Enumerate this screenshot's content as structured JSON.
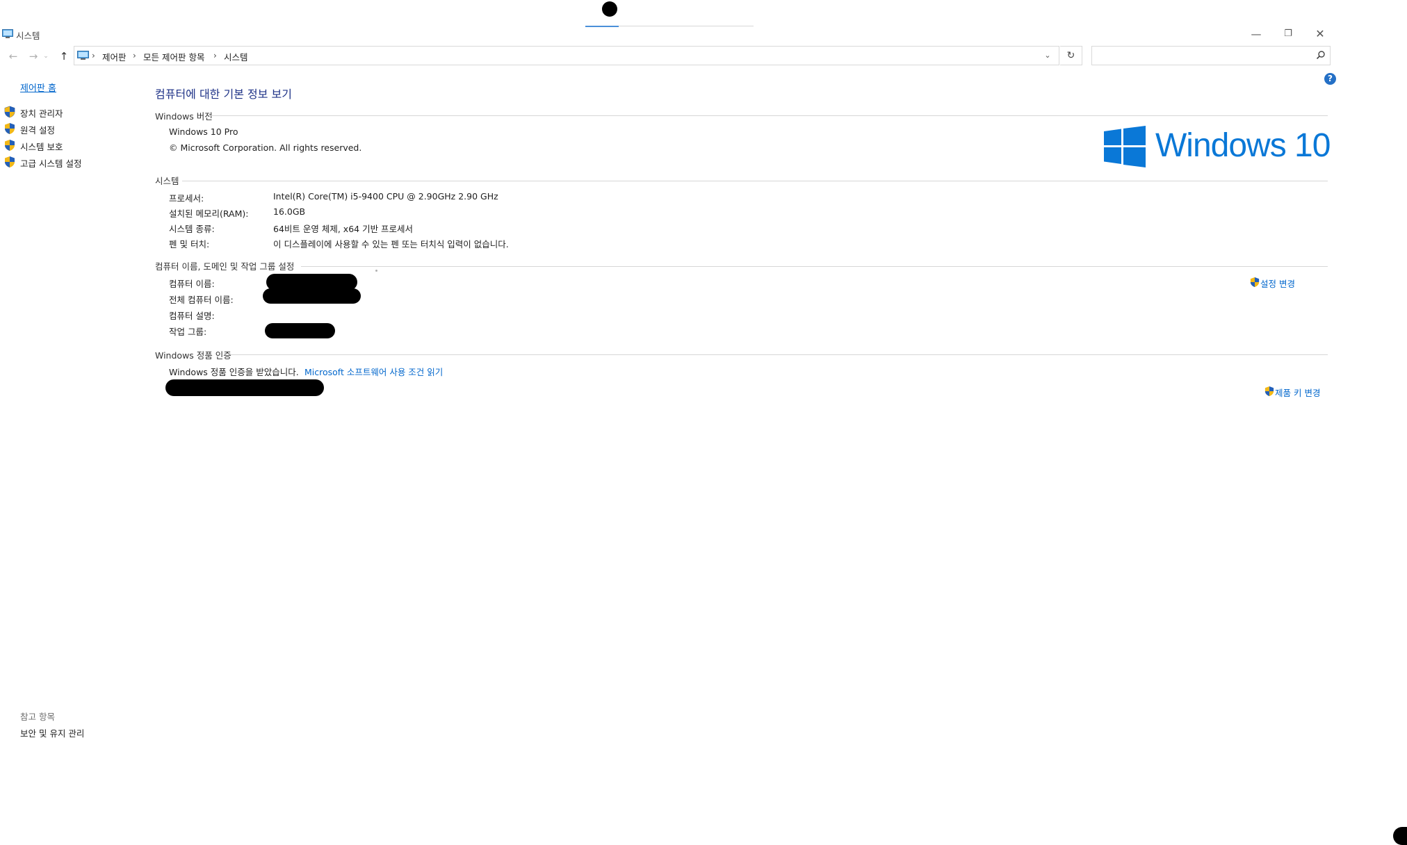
{
  "window": {
    "title": "시스템",
    "minimize": "—",
    "maximize": "❐",
    "close": "✕"
  },
  "nav": {
    "back": "←",
    "forward": "→",
    "recent": "⌄",
    "up": "↑",
    "breadcrumbs": [
      "제어판",
      "모든 제어판 항목",
      "시스템"
    ],
    "separator": "›",
    "dropdown": "⌄",
    "refresh": "↻",
    "search_value": ""
  },
  "sidebar": {
    "home": "제어판 홈",
    "items": [
      {
        "label": "장치 관리자"
      },
      {
        "label": "원격 설정"
      },
      {
        "label": "시스템 보호"
      },
      {
        "label": "고급 시스템 설정"
      }
    ],
    "see_also_header": "참고 항목",
    "see_also_items": [
      "보안 및 유지 관리"
    ]
  },
  "main": {
    "title": "컴퓨터에 대한 기본 정보 보기",
    "help": "?",
    "windows_edition": {
      "header": "Windows 버전",
      "edition": "Windows 10 Pro",
      "copyright": "© Microsoft Corporation. All rights reserved.",
      "logo_text": "Windows 10"
    },
    "system": {
      "header": "시스템",
      "rows": [
        {
          "label": "프로세서:",
          "value": "Intel(R) Core(TM) i5-9400 CPU @ 2.90GHz   2.90 GHz"
        },
        {
          "label": "설치된 메모리(RAM):",
          "value": "16.0GB"
        },
        {
          "label": "시스템 종류:",
          "value": "64비트 운영 체제, x64 기반 프로세서"
        },
        {
          "label": "펜 및 터치:",
          "value": "이 디스플레이에 사용할 수 있는 펜 또는 터치식 입력이 없습니다."
        }
      ]
    },
    "computer_name": {
      "header": "컴퓨터 이름, 도메인 및 작업 그룹 설정",
      "rows": [
        {
          "label": "컴퓨터 이름:"
        },
        {
          "label": "전체 컴퓨터 이름:"
        },
        {
          "label": "컴퓨터 설명:"
        },
        {
          "label": "작업 그룹:"
        }
      ],
      "change_settings": "설정 변경"
    },
    "activation": {
      "header": "Windows 정품 인증",
      "status": "Windows 정품 인증을 받았습니다.",
      "license_link": "Microsoft 소프트웨어 사용 조건 읽기",
      "change_key": "제품 키 변경"
    }
  },
  "colors": {
    "link": "#0066cc",
    "title": "#1e3287",
    "windows_blue": "#0a78d7",
    "rule": "#d6d6d6"
  }
}
